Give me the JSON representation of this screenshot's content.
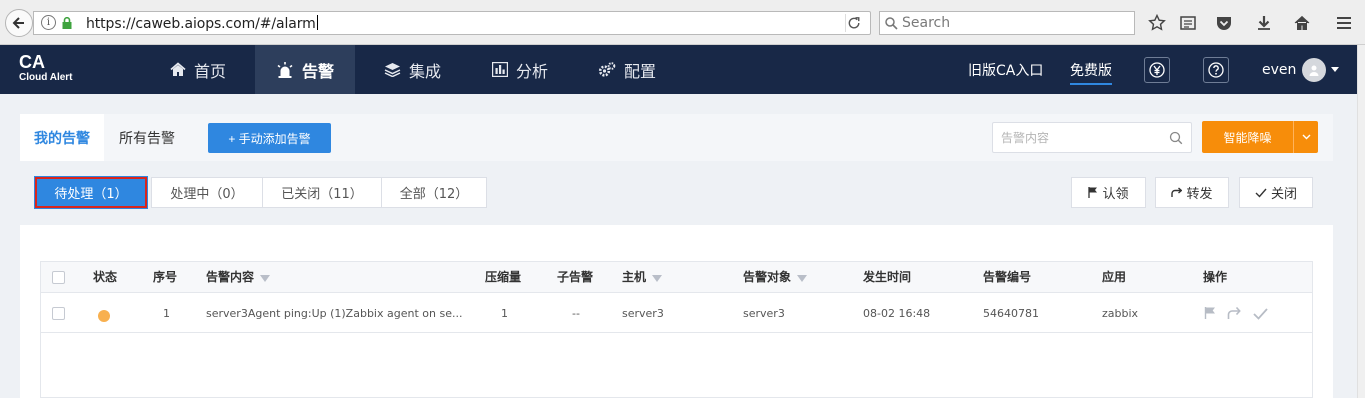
{
  "browser": {
    "url": "https://caweb.aiops.com/#/alarm",
    "search_placeholder": "Search"
  },
  "header": {
    "logo_main": "CA",
    "logo_sub": "Cloud Alert",
    "nav": [
      {
        "label": "首页",
        "icon": "home-icon"
      },
      {
        "label": "告警",
        "icon": "alarm-light-icon",
        "active": true
      },
      {
        "label": "集成",
        "icon": "layers-icon"
      },
      {
        "label": "分析",
        "icon": "bar-chart-icon"
      },
      {
        "label": "配置",
        "icon": "gears-icon"
      }
    ],
    "old_entry": "旧版CA入口",
    "free_version": "免费版",
    "username": "even"
  },
  "tabs": {
    "my_alarms": "我的告警",
    "all_alarms": "所有告警",
    "add_button": "+  手动添加告警",
    "search_placeholder": "告警内容",
    "smart_reduce": "智能降噪"
  },
  "filters": [
    {
      "label": "待处理（1）",
      "selected": true
    },
    {
      "label": "处理中（0）"
    },
    {
      "label": "已关闭（11）"
    },
    {
      "label": "全部（12）"
    }
  ],
  "actions": {
    "acknowledge": "认领",
    "forward": "转发",
    "close": "关闭"
  },
  "table": {
    "columns": [
      "状态",
      "序号",
      "告警内容",
      "压缩量",
      "子告警",
      "主机",
      "告警对象",
      "发生时间",
      "告警编号",
      "应用",
      "操作"
    ],
    "rows": [
      {
        "status_color": "#f8b04f",
        "index": "1",
        "content": "server3Agent ping:Up (1)Zabbix agent on se...",
        "compressed": "1",
        "sub_alarm": "--",
        "host": "server3",
        "target": "server3",
        "time": "08-02 16:48",
        "alarm_id": "54640781",
        "app": "zabbix"
      }
    ]
  },
  "colors": {
    "header_bg": "#182847",
    "primary": "#2f87e0",
    "orange": "#f78d0a",
    "status_pending": "#f8b04f"
  }
}
